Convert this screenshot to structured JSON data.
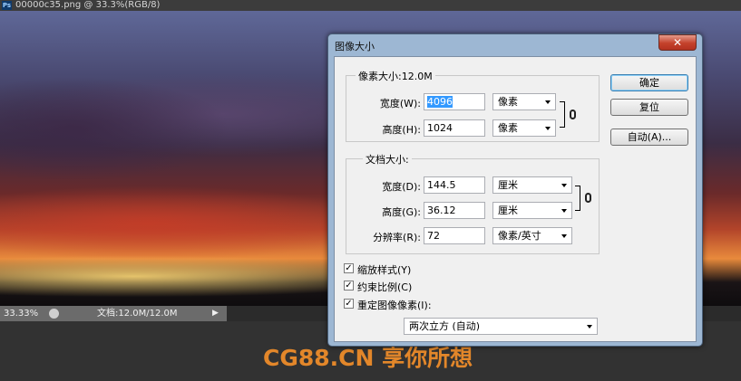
{
  "document": {
    "title": "00000c35.png @ 33.3%(RGB/8)",
    "app_icon": "Ps",
    "zoom": "33.33%",
    "doc_size": "文档:12.0M/12.0M"
  },
  "watermark": "CG88.CN 享你所想",
  "dialog": {
    "title": "图像大小",
    "close_glyph": "✕",
    "pixel_group": {
      "legend": "像素大小:12.0M",
      "width_label": "宽度(W):",
      "width_value": "4096",
      "width_unit": "像素",
      "height_label": "高度(H):",
      "height_value": "1024",
      "height_unit": "像素"
    },
    "doc_group": {
      "legend": "文档大小:",
      "width_label": "宽度(D):",
      "width_value": "144.5",
      "width_unit": "厘米",
      "height_label": "高度(G):",
      "height_value": "36.12",
      "height_unit": "厘米",
      "res_label": "分辨率(R):",
      "res_value": "72",
      "res_unit": "像素/英寸"
    },
    "checkboxes": [
      {
        "label": "缩放样式(Y)",
        "checked": true
      },
      {
        "label": "约束比例(C)",
        "checked": true
      },
      {
        "label": "重定图像像素(I):",
        "checked": true
      }
    ],
    "resample_method": "两次立方 (自动)",
    "buttons": {
      "ok": "确定",
      "reset": "复位",
      "auto": "自动(A)..."
    }
  }
}
